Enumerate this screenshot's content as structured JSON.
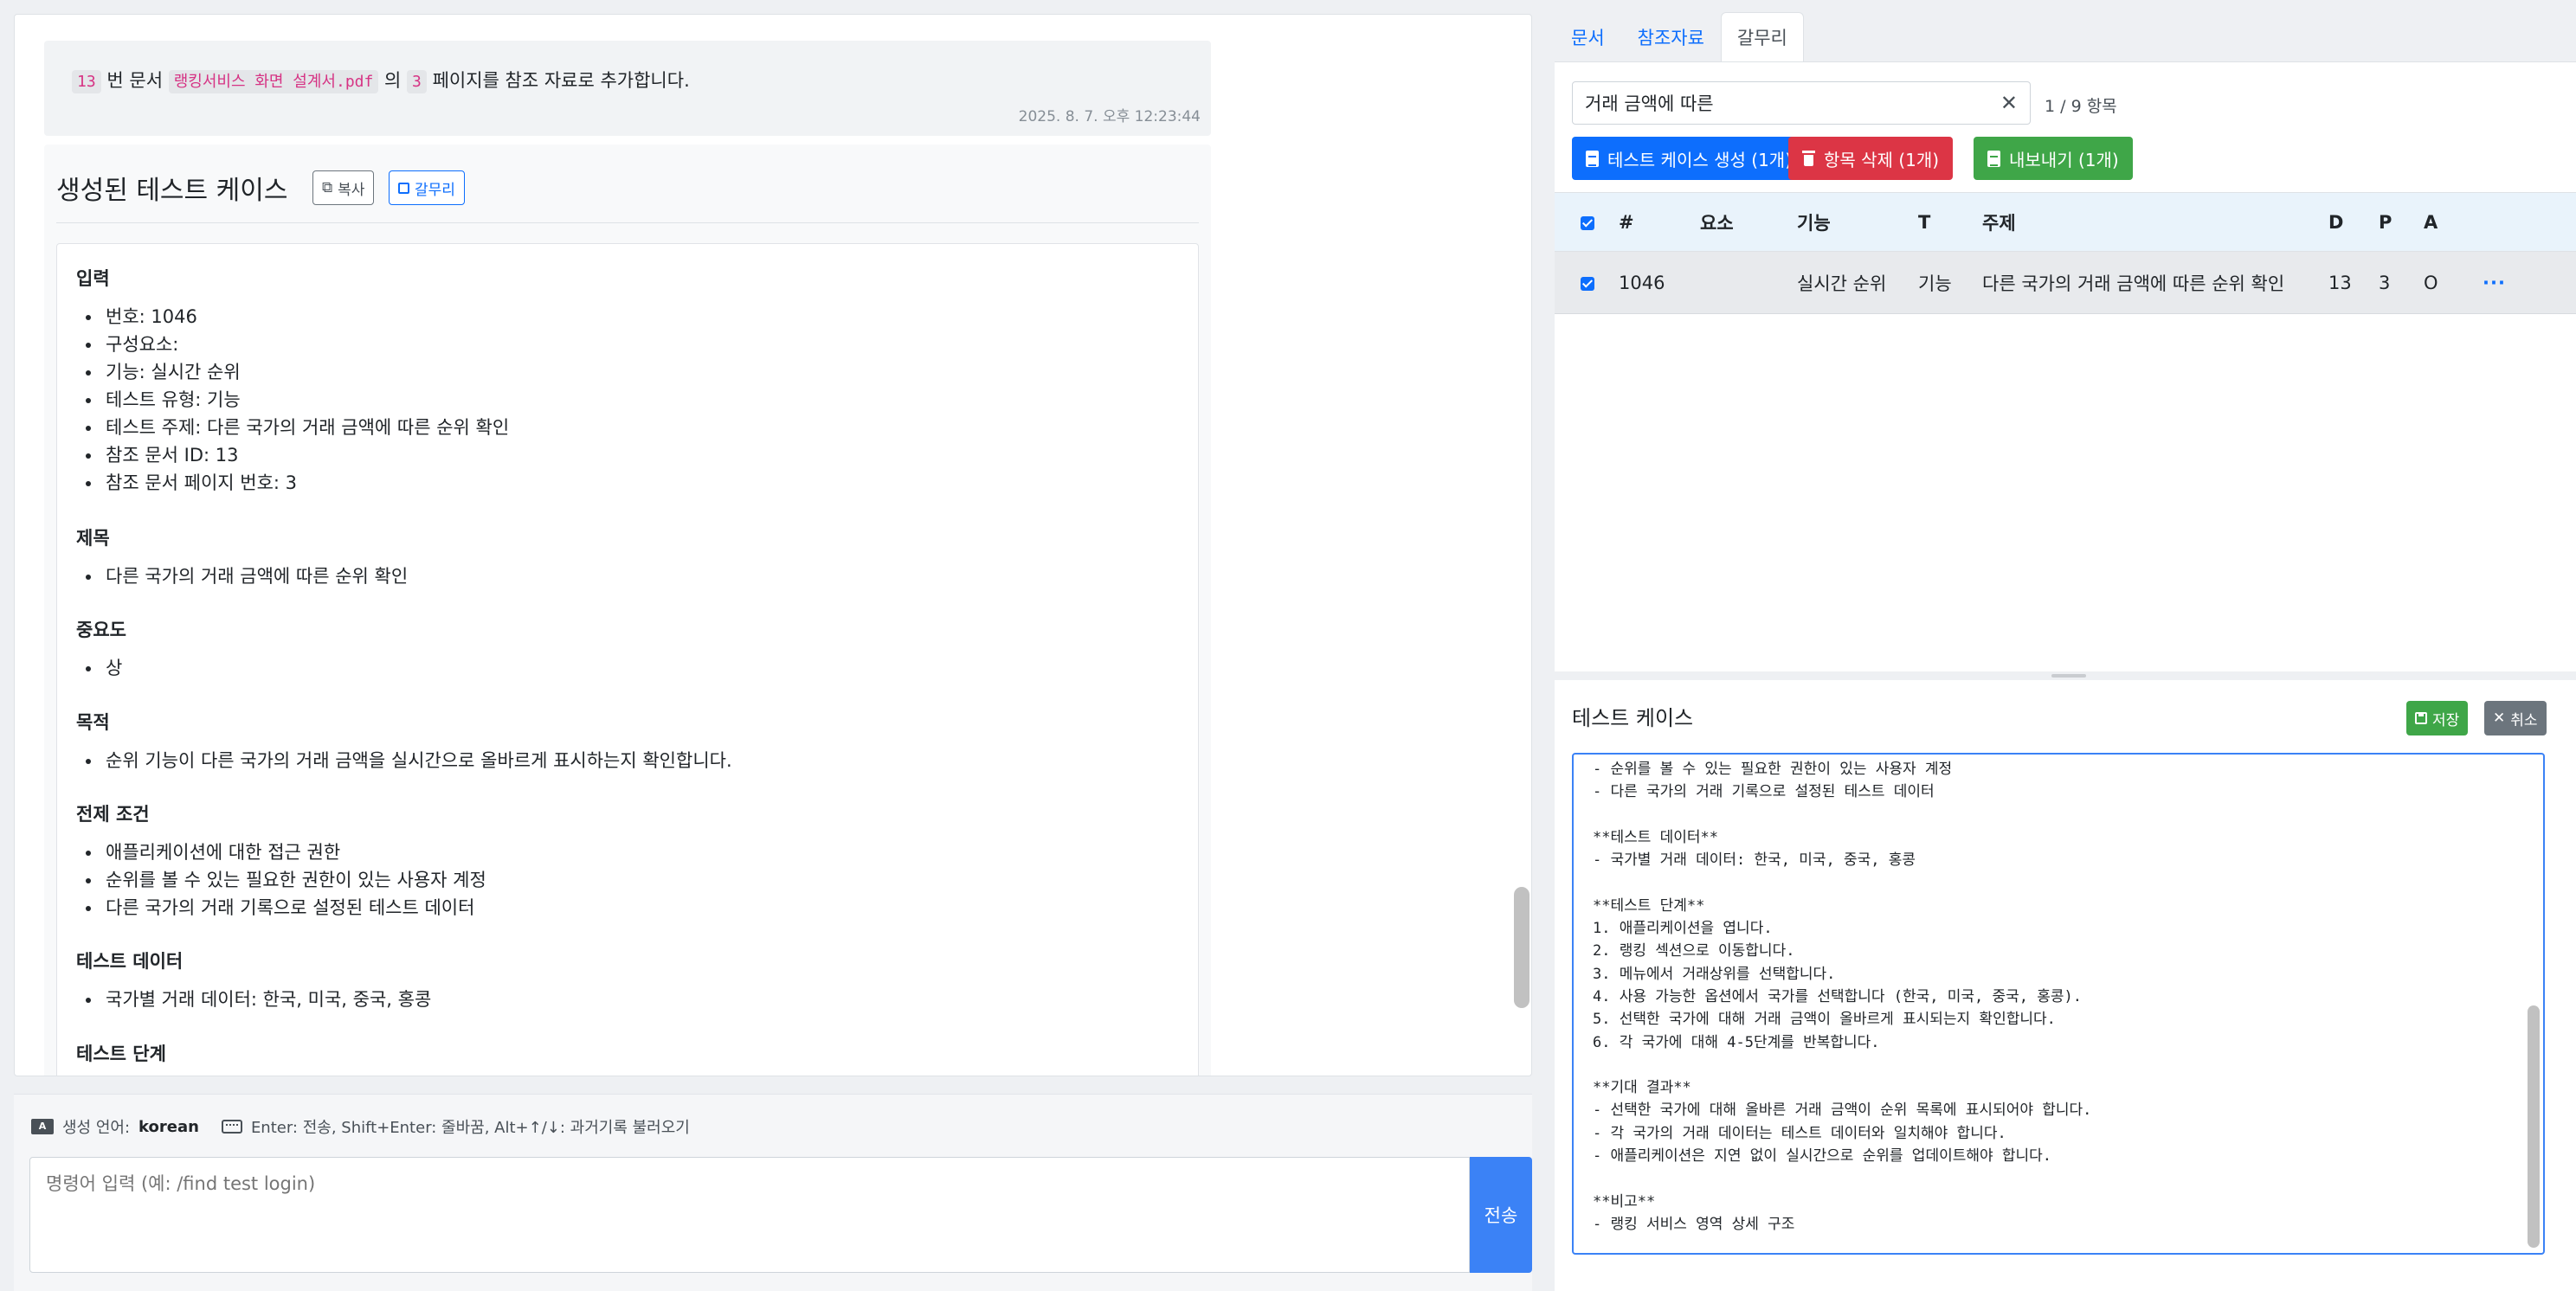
{
  "chat": {
    "reference_message": {
      "doc_number": "13",
      "text_1": "번 문서",
      "file_name": "랭킹서비스 화면 설계서.pdf",
      "text_2": "의",
      "page_number": "3",
      "text_3": "페이지를 참조 자료로 추가합니다.",
      "timestamp": "2025. 8. 7. 오후 12:23:44"
    },
    "testcase_message": {
      "title": "생성된 테스트 케이스",
      "copy_label": "복사",
      "save_label": "갈무리",
      "sections": [
        {
          "heading": "입력",
          "items": [
            "번호: 1046",
            "구성요소:",
            "기능: 실시간 순위",
            "테스트 유형: 기능",
            "테스트 주제: 다른 국가의 거래 금액에 따른 순위 확인",
            "참조 문서 ID: 13",
            "참조 문서 페이지 번호: 3"
          ]
        },
        {
          "heading": "제목",
          "items": [
            "다른 국가의 거래 금액에 따른 순위 확인"
          ]
        },
        {
          "heading": "중요도",
          "items": [
            "상"
          ]
        },
        {
          "heading": "목적",
          "items": [
            "순위 기능이 다른 국가의 거래 금액을 실시간으로 올바르게 표시하는지 확인합니다."
          ]
        },
        {
          "heading": "전제 조건",
          "items": [
            "애플리케이션에 대한 접근 권한",
            "순위를 볼 수 있는 필요한 권한이 있는 사용자 계정",
            "다른 국가의 거래 기록으로 설정된 테스트 데이터"
          ]
        },
        {
          "heading": "테스트 데이터",
          "items": [
            "국가별 거래 데이터: 한국, 미국, 중국, 홍콩"
          ]
        },
        {
          "heading": "테스트 단계",
          "items": []
        }
      ]
    }
  },
  "command_bar": {
    "lang_label": "생성 언어:",
    "lang_value": "korean",
    "shortcut_hint": "Enter: 전송, Shift+Enter: 줄바꿈, Alt+↑/↓: 과거기록 불러오기",
    "placeholder": "명령어 입력 (예: /find test login)",
    "send_label": "전송"
  },
  "right": {
    "tabs": [
      {
        "label": "문서",
        "active": false
      },
      {
        "label": "참조자료",
        "active": false
      },
      {
        "label": "갈무리",
        "active": true
      }
    ],
    "search": {
      "value": "거래 금액에 따른",
      "count": "1 / 9 항목"
    },
    "actions": {
      "generate_label": "테스트 케이스 생성 (1개)",
      "delete_label": "항목 삭제 (1개)",
      "export_label": "내보내기 (1개)"
    },
    "table": {
      "columns": [
        "#",
        "요소",
        "기능",
        "T",
        "주제",
        "D",
        "P",
        "A"
      ],
      "rows": [
        {
          "checked": true,
          "id": "1046",
          "element": "",
          "function": "실시간 순위",
          "type": "기능",
          "subject": "다른 국가의 거래 금액에 따른 순위 확인",
          "d": "13",
          "p": "3",
          "a": "O",
          "menu": "···"
        }
      ]
    },
    "detail": {
      "title": "테스트 케이스",
      "save_label": "저장",
      "cancel_label": "취소",
      "editor_text": "- 순위를 볼 수 있는 필요한 권한이 있는 사용자 계정\n- 다른 국가의 거래 기록으로 설정된 테스트 데이터\n\n**테스트 데이터**\n- 국가별 거래 데이터: 한국, 미국, 중국, 홍콩\n\n**테스트 단계**\n1. 애플리케이션을 엽니다.\n2. 랭킹 섹션으로 이동합니다.\n3. 메뉴에서 거래상위를 선택합니다.\n4. 사용 가능한 옵션에서 국가를 선택합니다 (한국, 미국, 중국, 홍콩).\n5. 선택한 국가에 대해 거래 금액이 올바르게 표시되는지 확인합니다.\n6. 각 국가에 대해 4-5단계를 반복합니다.\n\n**기대 결과**\n- 선택한 국가에 대해 올바른 거래 금액이 순위 목록에 표시되어야 합니다.\n- 각 국가의 거래 데이터는 테스트 데이터와 일치해야 합니다.\n- 애플리케이션은 지연 없이 실시간으로 순위를 업데이트해야 합니다.\n\n**비고**\n- 랭킹 서비스 영역 상세 구조"
    }
  },
  "colors": {
    "primary": "#0d6efd",
    "danger": "#dc3545",
    "success": "#3fa648",
    "secondary": "#6c757d",
    "send": "#3b82f6"
  }
}
